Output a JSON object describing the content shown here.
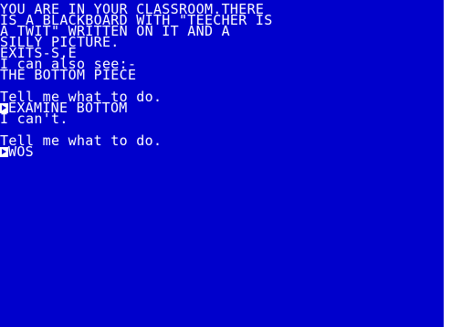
{
  "screen": {
    "background": "#0000cc",
    "foreground": "#ffffff",
    "lines": [
      "YOU ARE IN YOUR CLASSROOM.THERE",
      "IS A BLACKBOARD WITH \"TEECHER IS",
      "A TWIT\" WRITTEN ON IT AND A",
      "SILLY PICTURE.",
      "EXITS-S,E",
      "I can also see:-",
      "THE BOTTOM PIECE",
      "",
      "Tell me what to do.",
      "EXAMINE BOTTOM",
      "I can't.",
      "",
      "Tell me what to do.",
      "WOS"
    ],
    "prompt_icon": "input-prompt-arrow-icon"
  }
}
